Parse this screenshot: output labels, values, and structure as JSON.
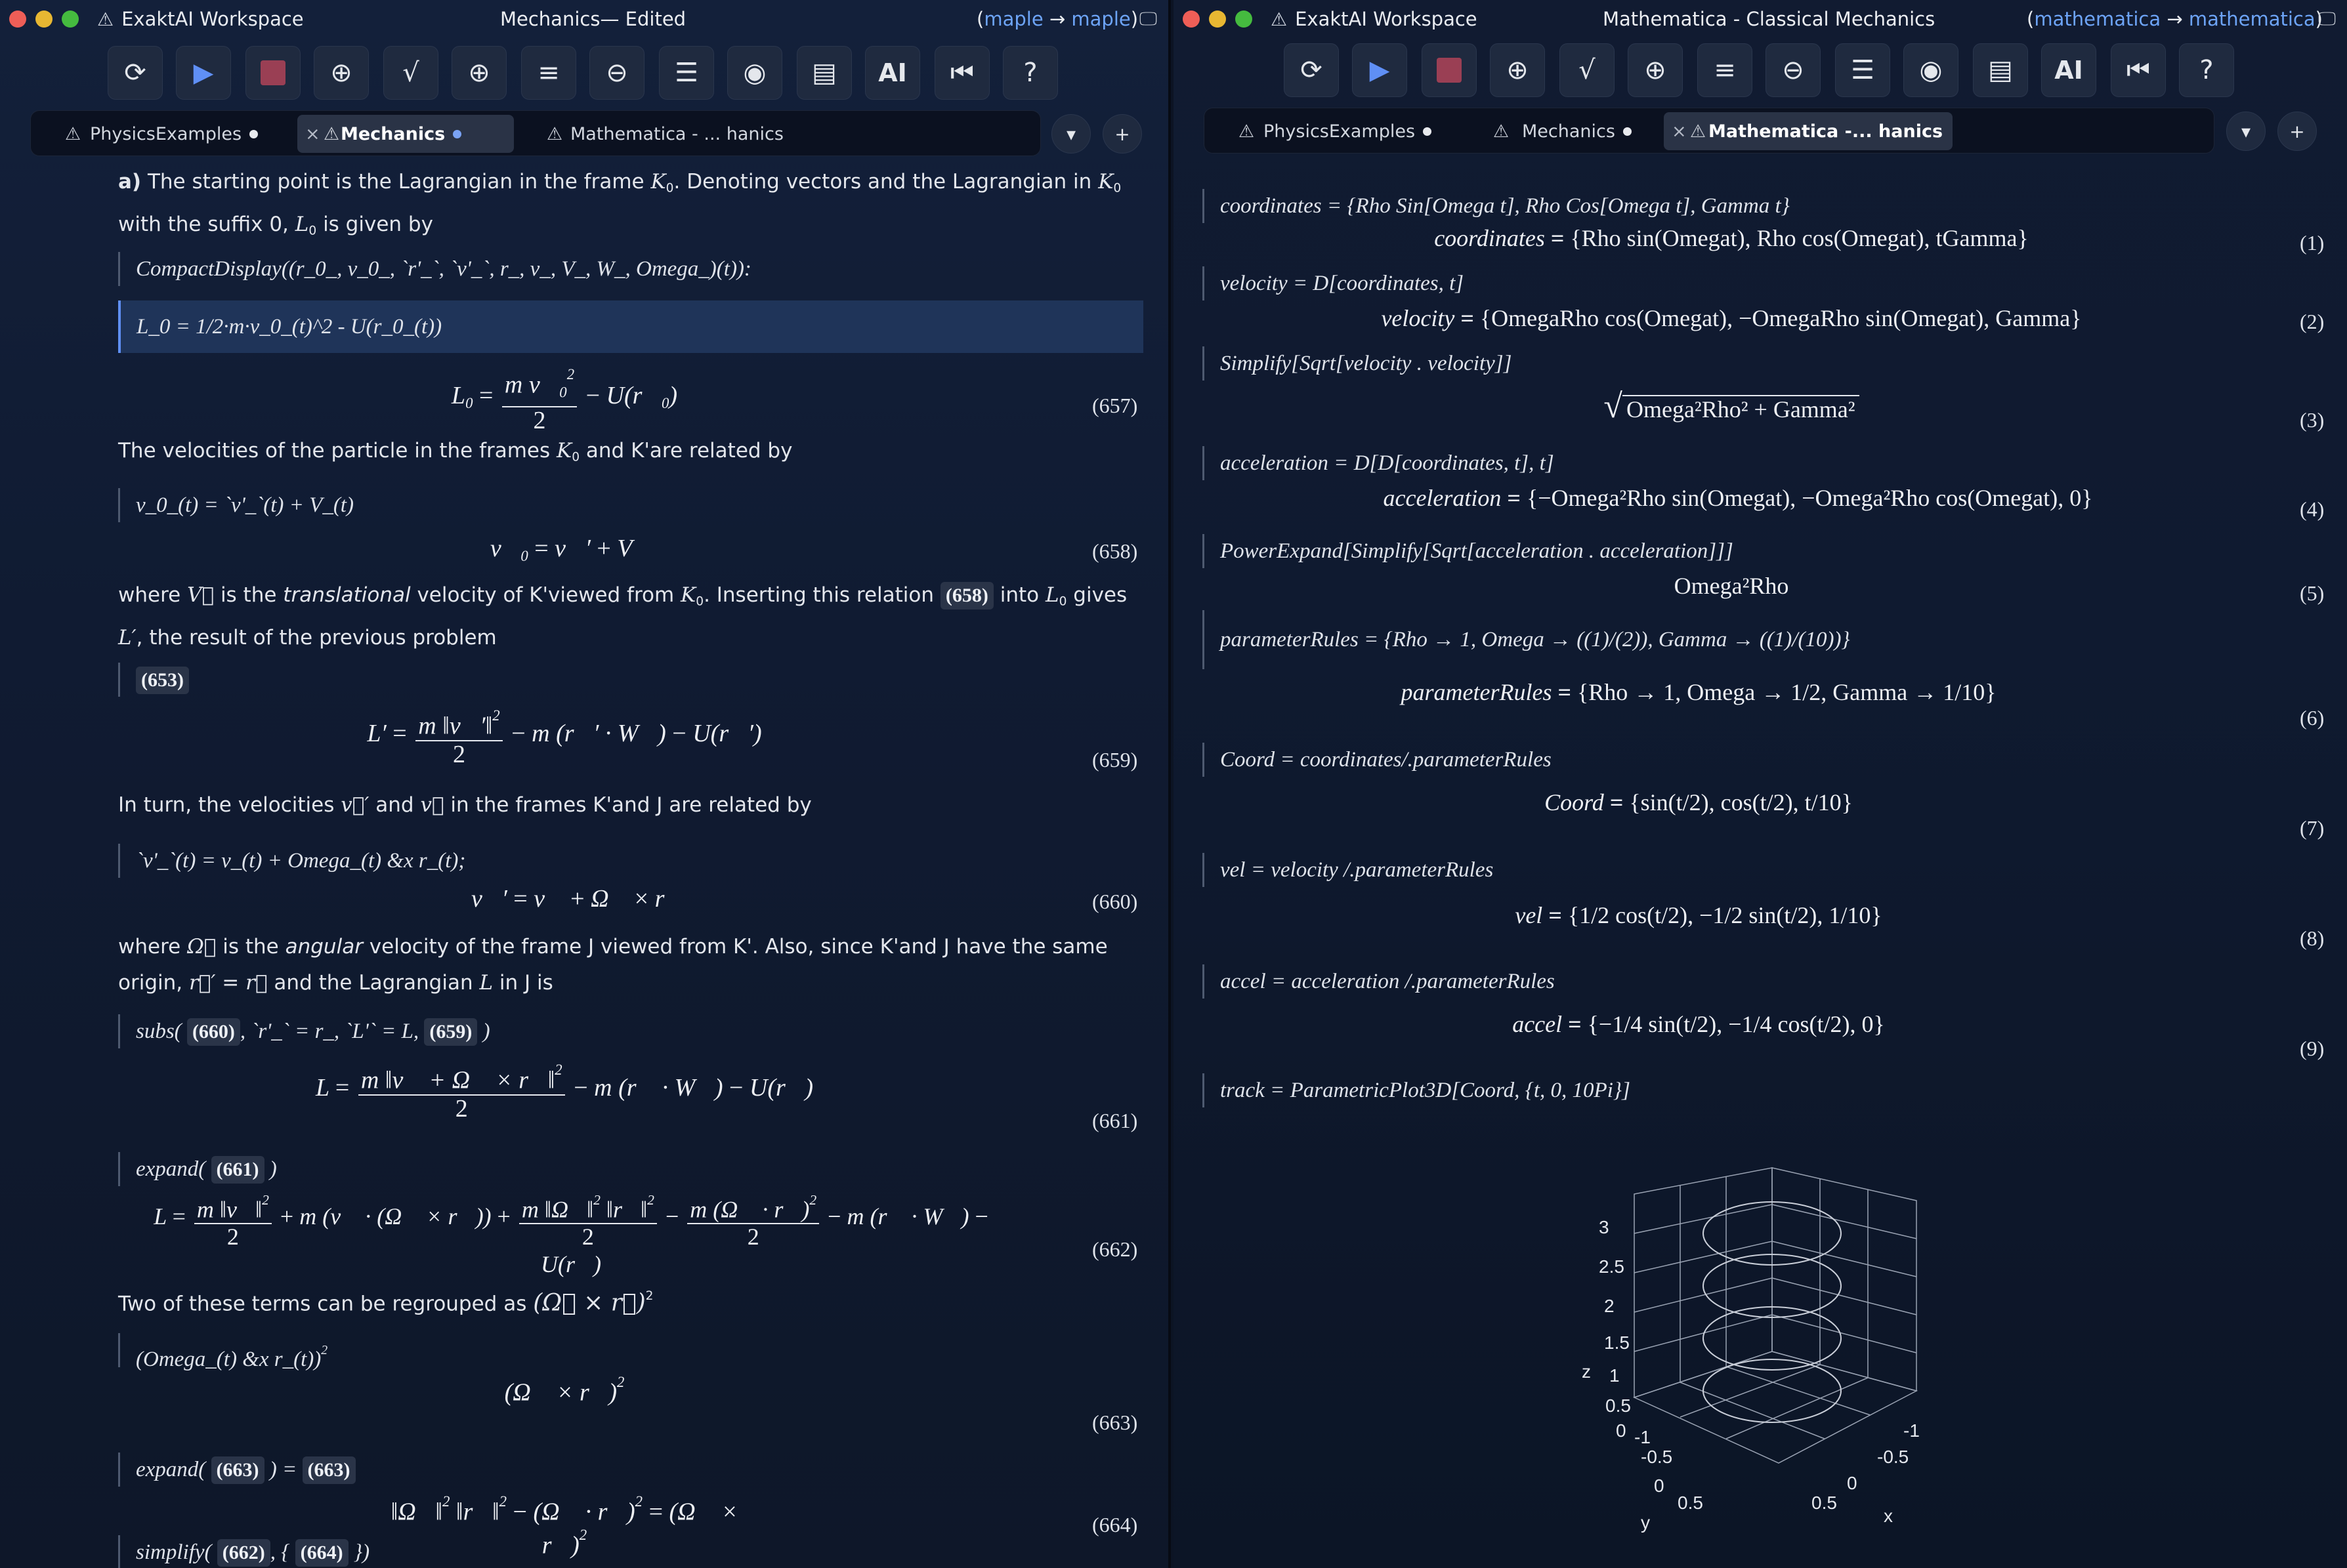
{
  "left": {
    "app_name": "ExaktAI Workspace",
    "title": "Mechanics— Edited",
    "kernel_from": "maple",
    "kernel_to": "maple",
    "tabs": [
      {
        "label": "PhysicsExamples",
        "active": false,
        "dot": true
      },
      {
        "label": "Mechanics",
        "active": true,
        "dot": true
      },
      {
        "label": "Mathematica - ... hanics",
        "active": false,
        "dot": false
      }
    ],
    "paragraph_a_label": "a)",
    "p1": "The starting point is the Lagrangian in the frame",
    "p1b": ". Denoting vectors and the Lagrangian in",
    "p1c": "with the suffix 0,",
    "p1d": "is given by",
    "in1": "CompactDisplay((r_0_, v_0_, `r'_`, `v'_`, r_, v_, V_, W_, Omega_)(t)):",
    "in2": "L_0 = 1/2·m·v_0_(t)^2 - U(r_0_(t))",
    "eq657": "(657)",
    "p2a": "The velocities of the particle in the frames",
    "p2b": "and K'are related by",
    "in3": "v_0_(t) = `v'_`(t) + V_(t)",
    "eq658": "(658)",
    "p3a": "where",
    "p3b": "is the",
    "p3c": "translational",
    "p3d": "velocity of K'viewed from",
    "p3e": ". Inserting this relation",
    "p3f": "into",
    "p3g": "gives",
    "p3h": ", the result of the previous problem",
    "ref653": "(653)",
    "ref658": "(658)",
    "eq659": "(659)",
    "p4a": "In turn, the velocities",
    "p4b": "and",
    "p4c": "in the frames K'and J are related by",
    "in4": "`v'_`(t) = v_(t) + Omega_(t) &x r_(t);",
    "eq660": "(660)",
    "p5a": "where",
    "p5b": "is the",
    "p5c": "angular",
    "p5d": "velocity of the frame J viewed from K'. Also, since K'and J have the same",
    "p5e": "origin,",
    "p5f": "and the Lagrangian",
    "p5g": "in J is",
    "in5a": "subs(",
    "in5_ref1": "(660)",
    "in5b": ", `r'_` = r_, `L'` = L,",
    "in5_ref2": "(659)",
    "in5c": ")",
    "eq661": "(661)",
    "in6a": "expand(",
    "in6_ref": "(661)",
    "in6b": ")",
    "eq662": "(662)",
    "p6": "Two of these terms can be regrouped as",
    "in7": "(Omega_(t) &x r_(t))",
    "eq663": "(663)",
    "in8a": "expand(",
    "in8_ref1": "(663)",
    "in8b": ") =",
    "in8_ref2": "(663)",
    "eq664": "(664)",
    "in9a": "simplify(",
    "in9_ref1": "(662)",
    "in9b": ", {",
    "in9_ref2": "(664)",
    "in9c": "})"
  },
  "right": {
    "app_name": "ExaktAI Workspace",
    "title": "Mathematica - Classical Mechanics",
    "kernel_from": "mathematica",
    "kernel_to": "mathematica",
    "tabs": [
      {
        "label": "PhysicsExamples",
        "active": false,
        "dot": true
      },
      {
        "label": "Mechanics",
        "active": false,
        "dot": true
      },
      {
        "label": "Mathematica -... hanics",
        "active": true,
        "dot": false
      }
    ],
    "in1": "coordinates = {Rho Sin[Omega t], Rho Cos[Omega t], Gamma  t}",
    "out1_lhs": "coordinates",
    "out1_rhs": "{Rho sin(Omegat), Rho cos(Omegat), tGamma}",
    "eq1": "(1)",
    "in2": "velocity = D[coordinates, t]",
    "out2_lhs": "velocity",
    "out2_rhs": "{OmegaRho cos(Omegat), −OmegaRho sin(Omegat), Gamma}",
    "eq2": "(2)",
    "in3": "Simplify[Sqrt[velocity . velocity]]",
    "out3": "Omega²Rho² + Gamma²",
    "eq3": "(3)",
    "in4": "acceleration = D[D[coordinates, t], t]",
    "out4_lhs": "acceleration",
    "out4_rhs": "{−Omega²Rho sin(Omegat), −Omega²Rho cos(Omegat), 0}",
    "eq4": "(4)",
    "in5": "PowerExpand[Simplify[Sqrt[acceleration . acceleration]]]",
    "out5": "Omega²Rho",
    "eq5": "(5)",
    "in6": "parameterRules = {Rho → 1, Omega → ((1)/(2)), Gamma → ((1)/(10))}",
    "out6_lhs": "parameterRules",
    "out6_rhs": "{Rho → 1, Omega → 1/2, Gamma → 1/10}",
    "eq6": "(6)",
    "in7": "Coord = coordinates/.parameterRules",
    "out7_lhs": "Coord",
    "out7_rhs": "{sin(t/2), cos(t/2), t/10}",
    "eq7": "(7)",
    "in8": "vel = velocity /.parameterRules",
    "out8_lhs": "vel",
    "out8_rhs": "{1/2 cos(t/2), −1/2 sin(t/2), 1/10}",
    "eq8": "(8)",
    "in9": "accel = acceleration /.parameterRules",
    "out9_lhs": "accel",
    "out9_rhs": "{−1/4 sin(t/2), −1/4 cos(t/2), 0}",
    "eq9": "(9)",
    "in10": "track = ParametricPlot3D[Coord, {t, 0, 10Pi}]",
    "plot": {
      "z_label": "z",
      "y_label": "y",
      "x_label": "x",
      "z_ticks": [
        "3",
        "2.5",
        "2",
        "1.5",
        "1",
        "0.5",
        "0"
      ],
      "y_ticks": [
        "-1",
        "-0.5",
        "0",
        "0.5"
      ],
      "x_ticks": [
        "-1",
        "-0.5",
        "0",
        "0.5"
      ]
    }
  },
  "colors": {
    "accent": "#5f8ff5",
    "background": "#111b31",
    "selection": "#1f3459",
    "stop": "#9a3f54"
  }
}
